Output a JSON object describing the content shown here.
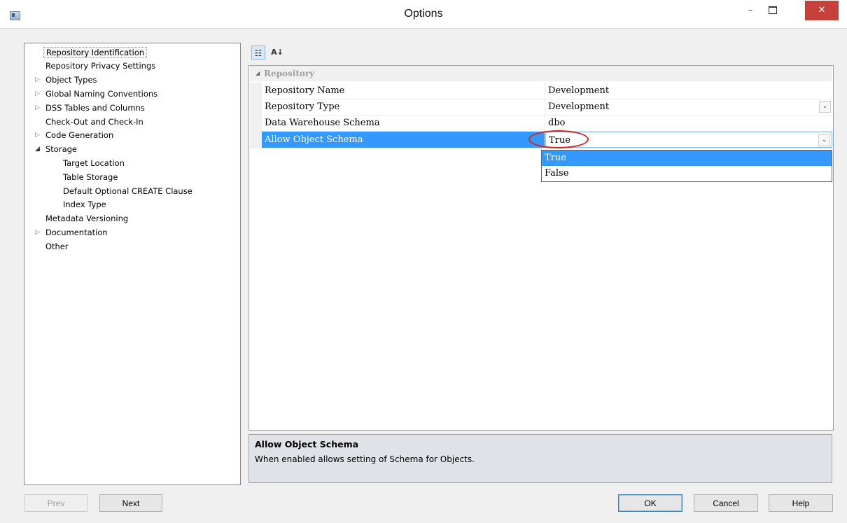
{
  "window": {
    "title": "Options",
    "minimize": "–",
    "close": "✕"
  },
  "tree": [
    {
      "label": "Repository Identification",
      "level": 0,
      "arrow": "",
      "selected": true
    },
    {
      "label": "Repository Privacy Settings",
      "level": 0,
      "arrow": ""
    },
    {
      "label": "Object Types",
      "level": 0,
      "arrow": "▷"
    },
    {
      "label": "Global Naming Conventions",
      "level": 0,
      "arrow": "▷"
    },
    {
      "label": "DSS Tables and Columns",
      "level": 0,
      "arrow": "▷"
    },
    {
      "label": "Check-Out and Check-In",
      "level": 0,
      "arrow": ""
    },
    {
      "label": "Code Generation",
      "level": 0,
      "arrow": "▷"
    },
    {
      "label": "Storage",
      "level": 0,
      "arrow": "◢"
    },
    {
      "label": "Target Location",
      "level": 1,
      "arrow": ""
    },
    {
      "label": "Table Storage",
      "level": 1,
      "arrow": ""
    },
    {
      "label": "Default Optional CREATE Clause",
      "level": 1,
      "arrow": ""
    },
    {
      "label": "Index Type",
      "level": 1,
      "arrow": ""
    },
    {
      "label": "Metadata Versioning",
      "level": 0,
      "arrow": ""
    },
    {
      "label": "Documentation",
      "level": 0,
      "arrow": "▷"
    },
    {
      "label": "Other",
      "level": 0,
      "arrow": ""
    }
  ],
  "toolbar": {
    "categorized_glyph": "☷",
    "alphabetical_glyph": "A↓"
  },
  "grid": {
    "category": "Repository",
    "category_glyph": "◢",
    "rows": [
      {
        "name": "Repository Name",
        "value": "Development"
      },
      {
        "name": "Repository Type",
        "value": "Development"
      },
      {
        "name": "Data Warehouse Schema",
        "value": "dbo"
      },
      {
        "name": "Allow Object Schema",
        "value": "True"
      }
    ],
    "dropdown_options": [
      "True",
      "False"
    ],
    "dropdown_glyph": "⌄"
  },
  "description": {
    "title": "Allow Object Schema",
    "text": "When enabled allows setting of Schema for Objects."
  },
  "buttons": {
    "prev": "Prev",
    "next": "Next",
    "ok": "OK",
    "cancel": "Cancel",
    "help": "Help"
  },
  "colors": {
    "selection": "#3399ff",
    "close": "#c7413b",
    "highlight": "#d9231d"
  },
  "icons": [
    "app-icon",
    "categorized-icon",
    "alphabetical-sort-icon",
    "expand-arrow-icon",
    "collapse-arrow-icon",
    "dropdown-arrow-icon"
  ]
}
